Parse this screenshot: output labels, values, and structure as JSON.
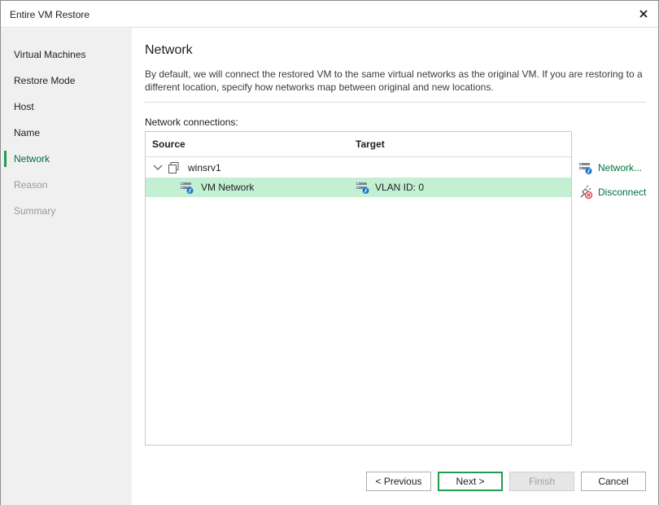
{
  "window": {
    "title": "Entire VM Restore"
  },
  "sidebar": {
    "steps": [
      {
        "label": "Virtual Machines",
        "state": "normal"
      },
      {
        "label": "Restore Mode",
        "state": "normal"
      },
      {
        "label": "Host",
        "state": "normal"
      },
      {
        "label": "Name",
        "state": "normal"
      },
      {
        "label": "Network",
        "state": "active"
      },
      {
        "label": "Reason",
        "state": "disabled"
      },
      {
        "label": "Summary",
        "state": "disabled"
      }
    ]
  },
  "main": {
    "title": "Network",
    "description": "By default, we will connect the restored VM to the same virtual networks as the original VM. If you are restoring to a different location, specify how networks map between original and new locations.",
    "connections_label": "Network connections:",
    "grid": {
      "columns": [
        "Source",
        "Target"
      ],
      "rows": [
        {
          "source": "winsrv1",
          "target": "",
          "type": "vm",
          "expanded": true
        },
        {
          "source": "VM Network",
          "target": "VLAN ID: 0",
          "type": "network",
          "selected": true
        }
      ]
    },
    "actions": {
      "network": "Network...",
      "disconnect": "Disconnect"
    }
  },
  "footer": {
    "previous": "< Previous",
    "next": "Next >",
    "finish": "Finish",
    "cancel": "Cancel"
  },
  "colors": {
    "accent": "#1e9d4f",
    "link": "#00713d",
    "selection": "#c3f0d3",
    "sidebar_bg": "#f0f0f0"
  },
  "icons": {
    "close": "close-icon",
    "expander": "chevron-down-icon",
    "vm": "vm-icon",
    "network": "network-icon",
    "disconnect": "disconnect-icon"
  }
}
